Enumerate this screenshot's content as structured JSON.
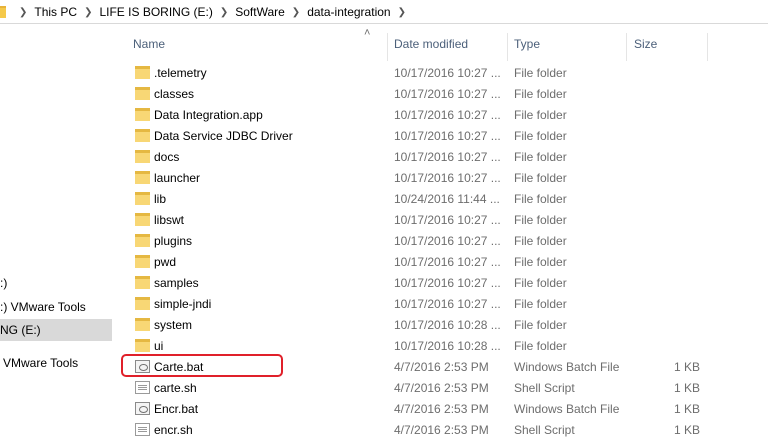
{
  "address": {
    "crumbs": [
      "This PC",
      "LIFE IS BORING (E:)",
      "SoftWare",
      "data-integration"
    ]
  },
  "nav": {
    "items": [
      ":)",
      ":) VMware Tools",
      "NG (E:)",
      "VMware Tools"
    ]
  },
  "columns": {
    "name": "Name",
    "date": "Date modified",
    "type": "Type",
    "size": "Size"
  },
  "rows": [
    {
      "name": ".telemetry",
      "date": "10/17/2016 10:27 ...",
      "type": "File folder",
      "size": "",
      "icon": "folder-icon"
    },
    {
      "name": "classes",
      "date": "10/17/2016 10:27 ...",
      "type": "File folder",
      "size": "",
      "icon": "folder-icon"
    },
    {
      "name": "Data Integration.app",
      "date": "10/17/2016 10:27 ...",
      "type": "File folder",
      "size": "",
      "icon": "folder-icon"
    },
    {
      "name": "Data Service JDBC Driver",
      "date": "10/17/2016 10:27 ...",
      "type": "File folder",
      "size": "",
      "icon": "folder-icon"
    },
    {
      "name": "docs",
      "date": "10/17/2016 10:27 ...",
      "type": "File folder",
      "size": "",
      "icon": "folder-icon"
    },
    {
      "name": "launcher",
      "date": "10/17/2016 10:27 ...",
      "type": "File folder",
      "size": "",
      "icon": "folder-icon"
    },
    {
      "name": "lib",
      "date": "10/24/2016 11:44 ...",
      "type": "File folder",
      "size": "",
      "icon": "folder-icon"
    },
    {
      "name": "libswt",
      "date": "10/17/2016 10:27 ...",
      "type": "File folder",
      "size": "",
      "icon": "folder-icon"
    },
    {
      "name": "plugins",
      "date": "10/17/2016 10:27 ...",
      "type": "File folder",
      "size": "",
      "icon": "folder-icon"
    },
    {
      "name": "pwd",
      "date": "10/17/2016 10:27 ...",
      "type": "File folder",
      "size": "",
      "icon": "folder-icon"
    },
    {
      "name": "samples",
      "date": "10/17/2016 10:27 ...",
      "type": "File folder",
      "size": "",
      "icon": "folder-icon"
    },
    {
      "name": "simple-jndi",
      "date": "10/17/2016 10:27 ...",
      "type": "File folder",
      "size": "",
      "icon": "folder-icon"
    },
    {
      "name": "system",
      "date": "10/17/2016 10:28 ...",
      "type": "File folder",
      "size": "",
      "icon": "folder-icon"
    },
    {
      "name": "ui",
      "date": "10/17/2016 10:28 ...",
      "type": "File folder",
      "size": "",
      "icon": "folder-icon"
    },
    {
      "name": "Carte.bat",
      "date": "4/7/2016 2:53 PM",
      "type": "Windows Batch File",
      "size": "1 KB",
      "icon": "batch-file-icon"
    },
    {
      "name": "carte.sh",
      "date": "4/7/2016 2:53 PM",
      "type": "Shell Script",
      "size": "1 KB",
      "icon": "shell-script-icon"
    },
    {
      "name": "Encr.bat",
      "date": "4/7/2016 2:53 PM",
      "type": "Windows Batch File",
      "size": "1 KB",
      "icon": "batch-file-icon"
    },
    {
      "name": "encr.sh",
      "date": "4/7/2016 2:53 PM",
      "type": "Shell Script",
      "size": "1 KB",
      "icon": "shell-script-icon"
    }
  ],
  "highlight_color": "#e0202a"
}
